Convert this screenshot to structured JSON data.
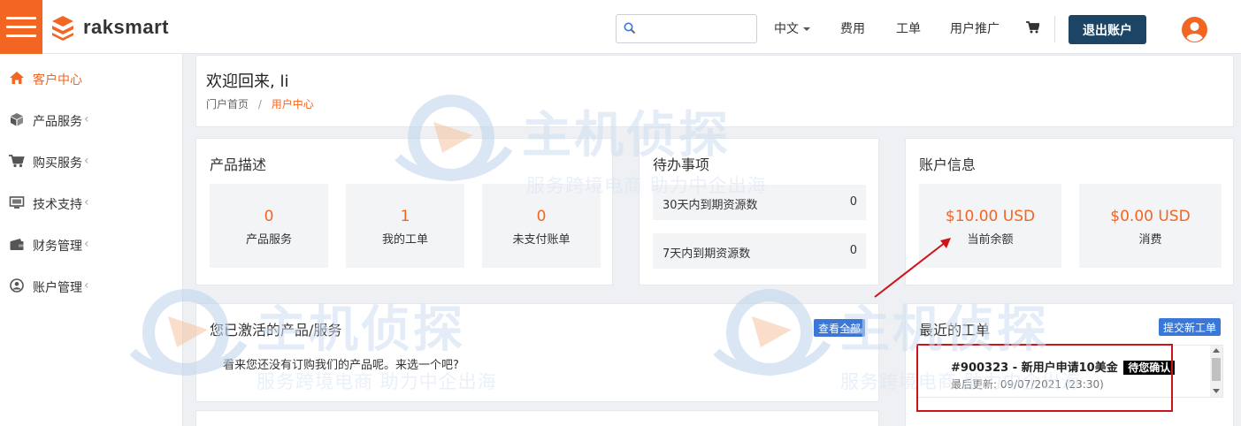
{
  "header": {
    "brand": "raksmart",
    "search_placeholder": "",
    "nav": {
      "language": "中文",
      "billing": "费用",
      "tickets": "工单",
      "affiliate": "用户推广"
    },
    "logout_label": "退出账户"
  },
  "sidebar": {
    "items": [
      {
        "label": "客户中心"
      },
      {
        "label": "产品服务"
      },
      {
        "label": "购买服务"
      },
      {
        "label": "技术支持"
      },
      {
        "label": "财务管理"
      },
      {
        "label": "账户管理"
      }
    ]
  },
  "welcome": {
    "title": "欢迎回来, li",
    "breadcrumb_home": "门户首页",
    "breadcrumb_sep": "/",
    "breadcrumb_current": "用户中心"
  },
  "products": {
    "title": "产品描述",
    "tiles": [
      {
        "value": "0",
        "label": "产品服务"
      },
      {
        "value": "1",
        "label": "我的工单"
      },
      {
        "value": "0",
        "label": "未支付账单"
      }
    ]
  },
  "todo": {
    "title": "待办事项",
    "rows": [
      {
        "label": "30天内到期资源数",
        "value": "0"
      },
      {
        "label": "7天内到期资源数",
        "value": "0"
      }
    ]
  },
  "account": {
    "title": "账户信息",
    "tiles": [
      {
        "value": "$10.00 USD",
        "label": "当前余额"
      },
      {
        "value": "$0.00 USD",
        "label": "消费"
      }
    ]
  },
  "active_services": {
    "title": "您已激活的产品/服务",
    "view_all": "查看全部",
    "empty_text": "看来您还没有订购我们的产品呢。来选一个吧?"
  },
  "recent_tickets": {
    "title": "最近的工单",
    "new_ticket": "提交新工单",
    "ticket": {
      "subject": "#900323 - 新用户申请10美金",
      "status": "待您确认",
      "updated": "最后更新: 09/07/2021 (23:30)"
    }
  },
  "watermark": {
    "main": "主机侦探",
    "sub": "服务跨境电商 助力中企出海"
  },
  "colors": {
    "accent": "#f26522",
    "primary_dark": "#1c4565",
    "button_blue": "#3b77d6",
    "highlight_red": "#d0131b"
  }
}
